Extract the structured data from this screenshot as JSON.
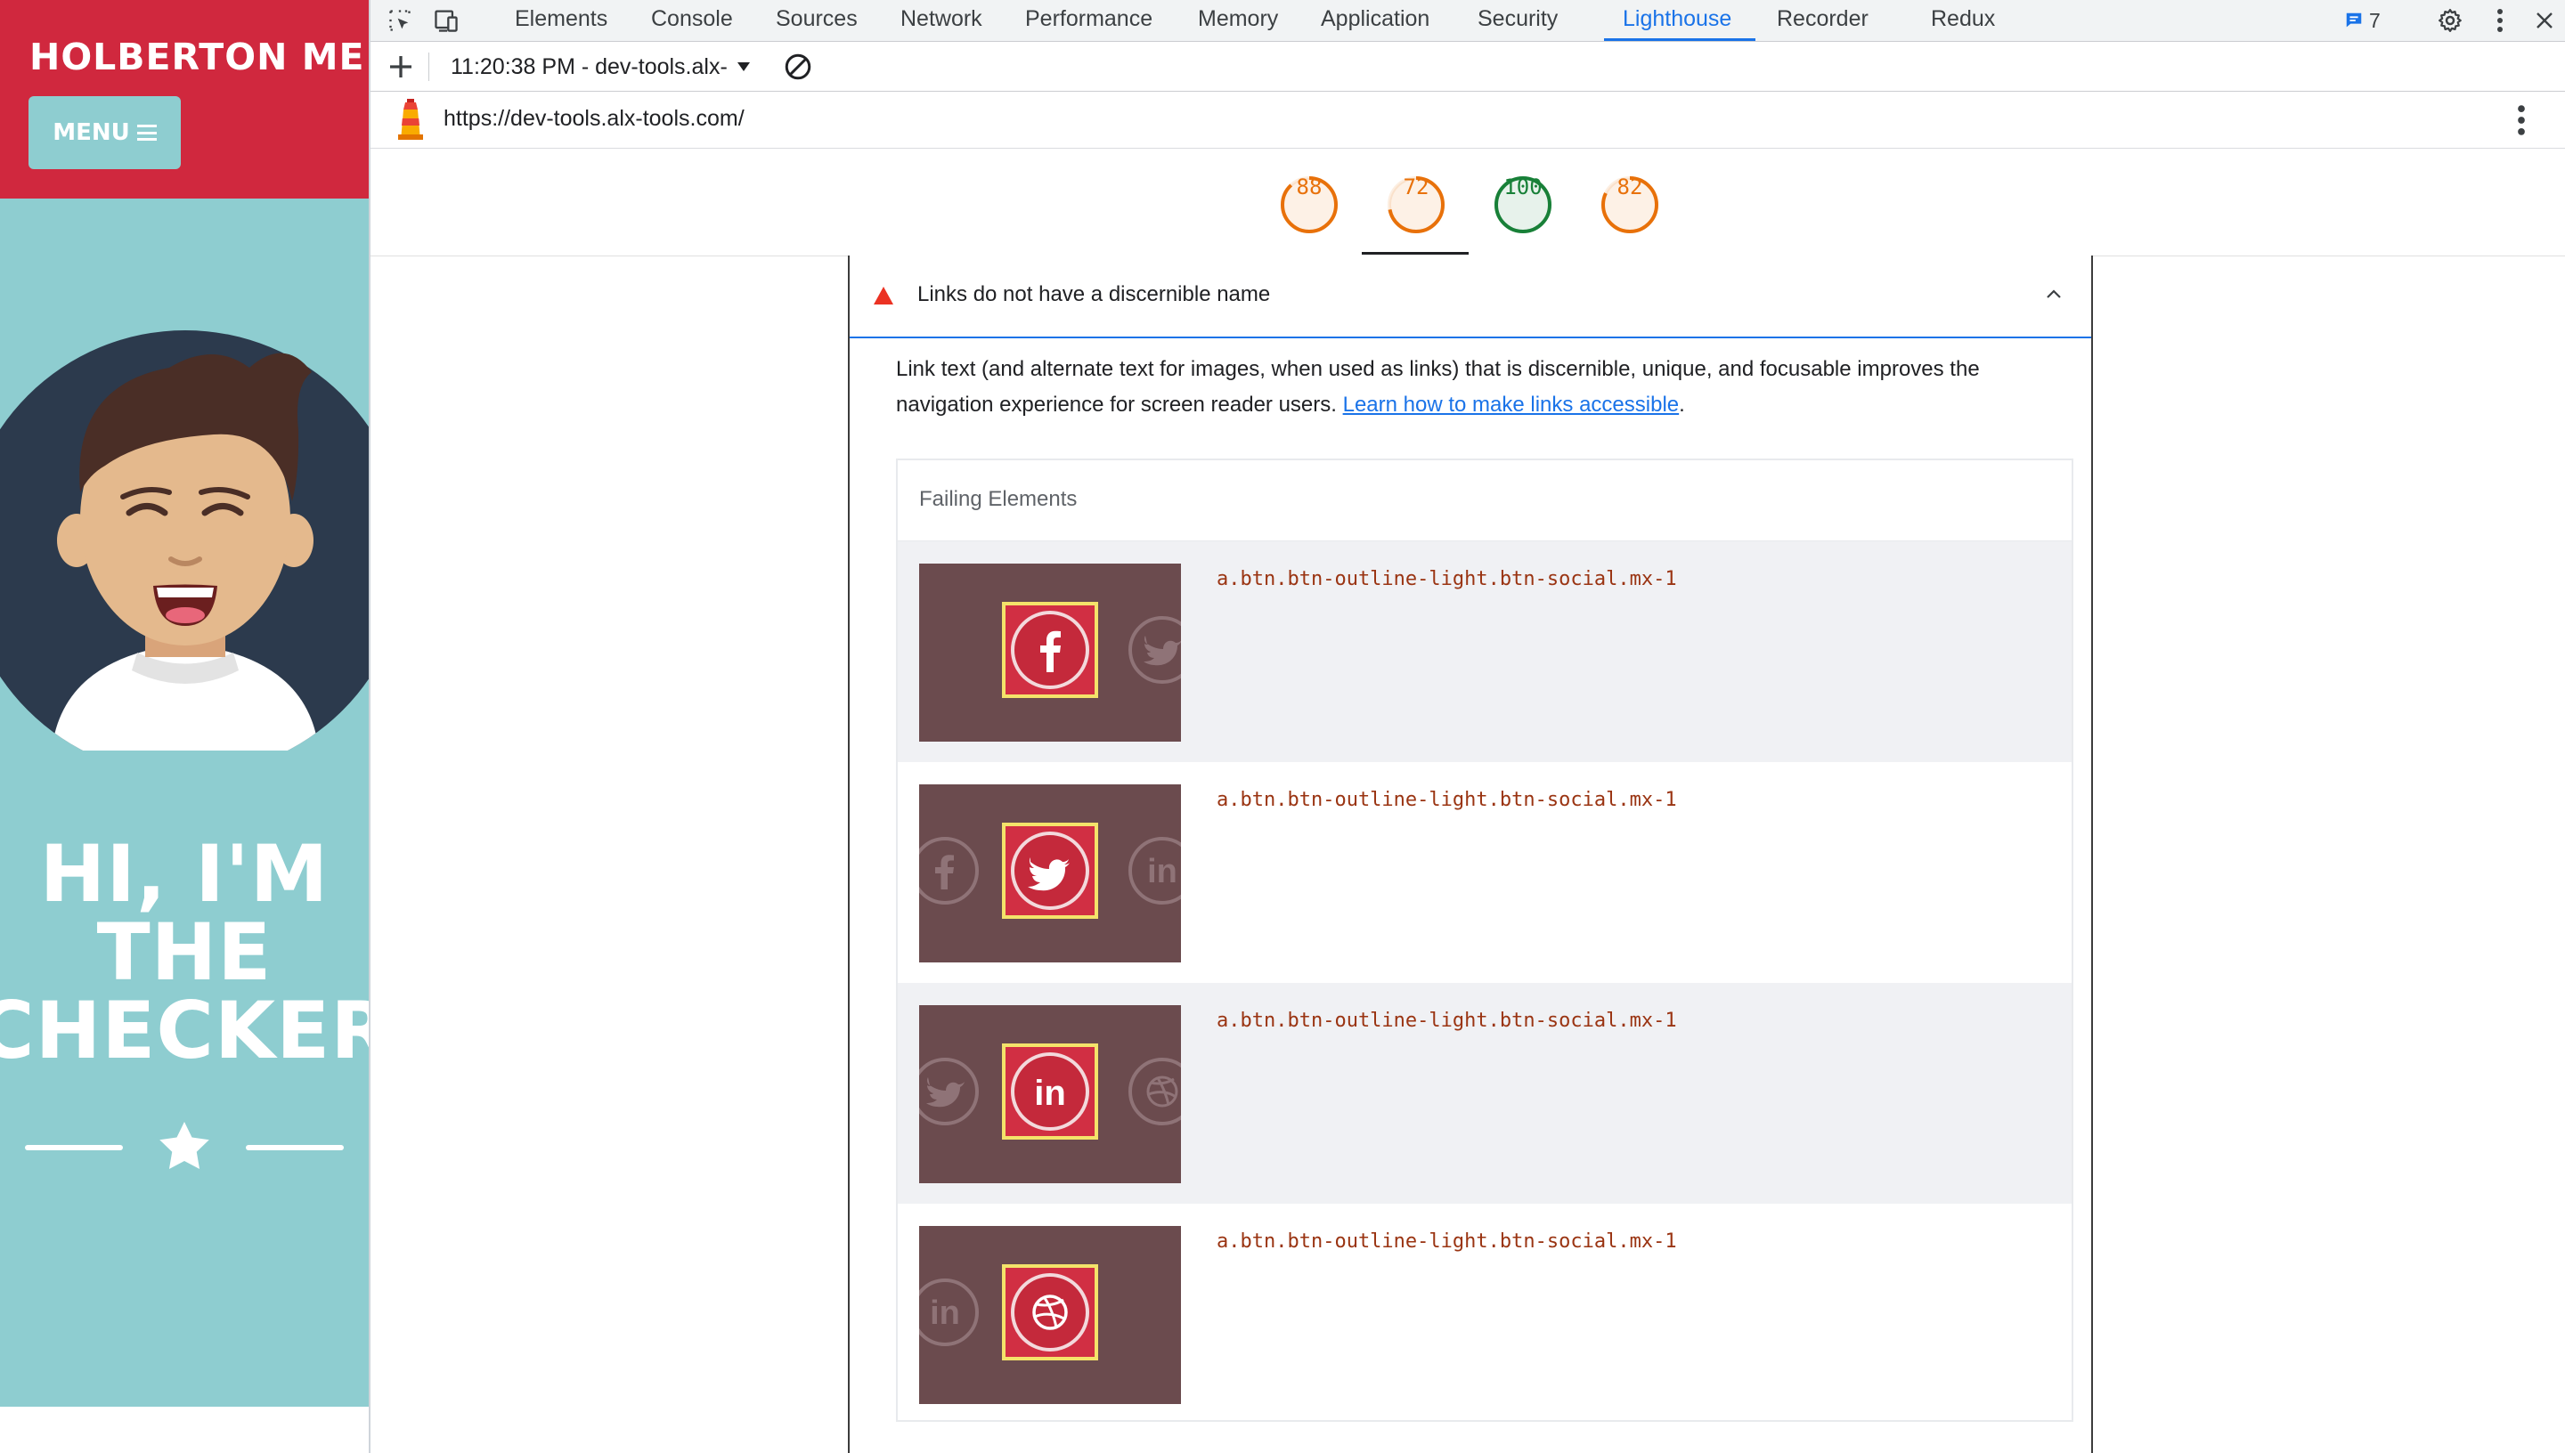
{
  "site": {
    "brand": "HOLBERTON ME",
    "menu_label": "MENU",
    "hero_lines": [
      "HI, I'M",
      "THE",
      "CHECKER"
    ]
  },
  "devtools": {
    "tabs": [
      "Elements",
      "Console",
      "Sources",
      "Network",
      "Performance",
      "Memory",
      "Application",
      "Security",
      "Lighthouse",
      "Recorder",
      "Redux"
    ],
    "active_tab": "Lighthouse",
    "issues_count": "7",
    "report_selector": "11:20:38 PM - dev-tools.alx-",
    "report_url": "https://dev-tools.alx-tools.com/",
    "scores": [
      {
        "value": "88",
        "color": "#e8710a"
      },
      {
        "value": "72",
        "color": "#e8710a"
      },
      {
        "value": "100",
        "color": "#188038"
      },
      {
        "value": "82",
        "color": "#e8710a"
      }
    ],
    "audit": {
      "title": "Links do not have a discernible name",
      "description": "Link text (and alternate text for images, when used as links) that is discernible, unique, and focusable improves the navigation experience for screen reader users. ",
      "learn_more": "Learn how to make links accessible",
      "description_end": ".",
      "failing_header": "Failing Elements",
      "items": [
        {
          "selector": "a.btn.btn-outline-light.btn-social.mx-1",
          "icon": "facebook-icon"
        },
        {
          "selector": "a.btn.btn-outline-light.btn-social.mx-1",
          "icon": "twitter-icon"
        },
        {
          "selector": "a.btn.btn-outline-light.btn-social.mx-1",
          "icon": "linkedin-icon"
        },
        {
          "selector": "a.btn.btn-outline-light.btn-social.mx-1",
          "icon": "dribbble-icon"
        }
      ]
    }
  },
  "colors": {
    "brand_red": "#d0283e",
    "teal": "#8ecdd0",
    "lighthouse_blue": "#1a73e8",
    "thumb_bg": "#6b4b4e",
    "highlight_yellow": "#f4e36a"
  }
}
